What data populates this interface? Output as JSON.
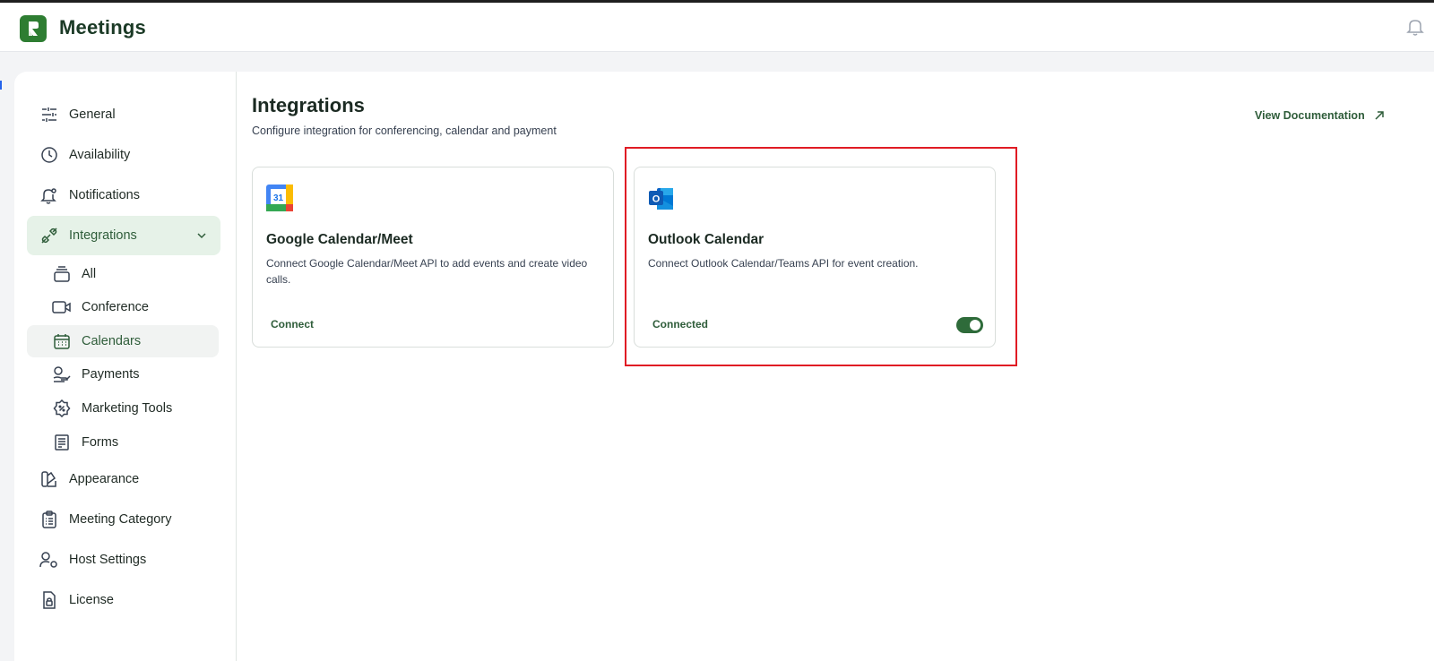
{
  "app": {
    "title": "Meetings"
  },
  "sidebar": {
    "items": [
      {
        "label": "General",
        "icon": "sliders-icon"
      },
      {
        "label": "Availability",
        "icon": "clock-icon"
      },
      {
        "label": "Notifications",
        "icon": "bell-icon"
      },
      {
        "label": "Integrations",
        "icon": "plug-icon",
        "active": true,
        "expanded": true
      },
      {
        "label": "Appearance",
        "icon": "palette-icon"
      },
      {
        "label": "Meeting Category",
        "icon": "clipboard-icon"
      },
      {
        "label": "Host Settings",
        "icon": "user-settings-icon"
      },
      {
        "label": "License",
        "icon": "lock-file-icon"
      }
    ],
    "subitems": [
      {
        "label": "All",
        "icon": "stack-icon"
      },
      {
        "label": "Conference",
        "icon": "video-icon"
      },
      {
        "label": "Calendars",
        "icon": "calendar-icon",
        "selected": true
      },
      {
        "label": "Payments",
        "icon": "payment-icon"
      },
      {
        "label": "Marketing Tools",
        "icon": "discount-icon"
      },
      {
        "label": "Forms",
        "icon": "form-icon"
      }
    ]
  },
  "main": {
    "title": "Integrations",
    "subtitle": "Configure integration for conferencing, calendar and payment",
    "doc_link": "View Documentation",
    "cards": [
      {
        "title": "Google Calendar/Meet",
        "description": "Connect Google Calendar/Meet API to add events and create video calls.",
        "action": "Connect",
        "icon": "google-calendar-icon",
        "icon_text": "31"
      },
      {
        "title": "Outlook Calendar",
        "description": "Connect Outlook Calendar/Teams API for event creation.",
        "action": "Connected",
        "icon": "outlook-icon",
        "icon_text": "O",
        "toggle_on": true
      }
    ]
  },
  "colors": {
    "accent": "#2e6b3a",
    "active_bg": "#e6f2e8",
    "highlight": "#e01b24"
  }
}
